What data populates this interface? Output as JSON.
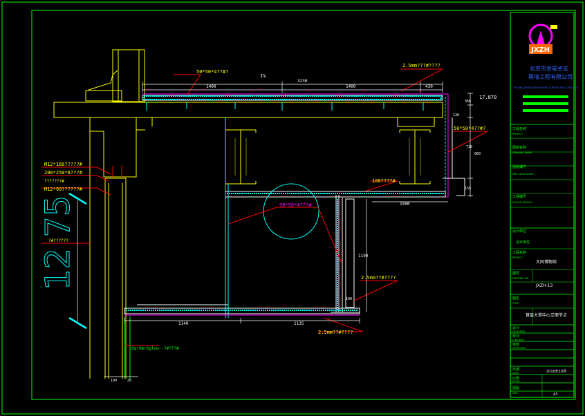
{
  "drawing": {
    "dims": {
      "slope": "1%",
      "span_total": "3230",
      "span_left": "1400",
      "span_mid": "1400",
      "span_right": "430",
      "elev": "17.870",
      "right_top": "360",
      "right_130": "130",
      "right_710": "710",
      "right_860": "860",
      "right_150": "150",
      "mid_1500": "1500",
      "mid_1190": "1190",
      "mid_100": "100",
      "bottom_1140": "1140",
      "bottom_1135": "1135",
      "bottom_190": "190",
      "bottom_20": "20",
      "big_height": "12 75",
      "small_150": "150"
    },
    "annotations": {
      "steel_angle_top": "50*50*4??#?",
      "alu_panel_top": "2.5mm???#????",
      "angle_right": "50*50*4??#?",
      "steel_100": "100????#",
      "angle_circle": "50*50*4???#",
      "alu_panel_mid": "2.5mm??#????",
      "alu_panel_bottom": "2.5mm??#????",
      "anchor": "M12*160?????#",
      "plate": "200*250*8???#",
      "bolt_row": "???????#",
      "bolt2": "M12*90??????#",
      "column_note": "?#??????",
      "glass": "6q+9A+6glow--?#???#"
    }
  },
  "titleblock": {
    "company_cn": "北京市金星卓宏",
    "company_cn2": "幕墙工程有限公司",
    "company_en": "BEIJING JINXINGZHUOHONG CURTAIN WALL ENG. CO.",
    "logo_text": "JXZH",
    "r1_label": "工程名称",
    "r1_en": "PROJECT",
    "r2_label": "图纸名称",
    "r2_en": "DRAWING NAME",
    "r3_label": "图纸编号",
    "r3_en": "Wall Construction",
    "r4_label": "工程编号",
    "r4_en": "DESIGN DETAILS",
    "r5_label": "设计单位",
    "r5_en": "设计单位",
    "r6_label": "工程名称",
    "r6_en": "PROJECT",
    "r6_value": "大同博物馆",
    "r7_label": "图号",
    "r7_en": "DRAWING NO.",
    "r7_value": "JXZH-13",
    "r8_label": "图名",
    "r8_en": "TITLE",
    "r8_value": "首层大堂中心立面节点",
    "r9_label": "设计",
    "r9_en": "DESIGNED",
    "r10_label": "校对",
    "r10_en": "CHECKED",
    "r11_label": "审核",
    "r11_en": "APPROVED",
    "r12_label": "日期",
    "r12_en": "DATE",
    "r12_value": "2010年10月",
    "r13_label": "比例",
    "r13_en": "SCALE",
    "r14_label": "图幅",
    "r14_en": "SIZE",
    "r14_value": "A3"
  },
  "colors": {
    "frame": "#00ff00",
    "structure": "#ffff00",
    "profile": "#ff00ff",
    "panel": "#00ffff",
    "leader": "#ff0000",
    "white": "#ffffff",
    "title_blue": "#3366ff"
  }
}
